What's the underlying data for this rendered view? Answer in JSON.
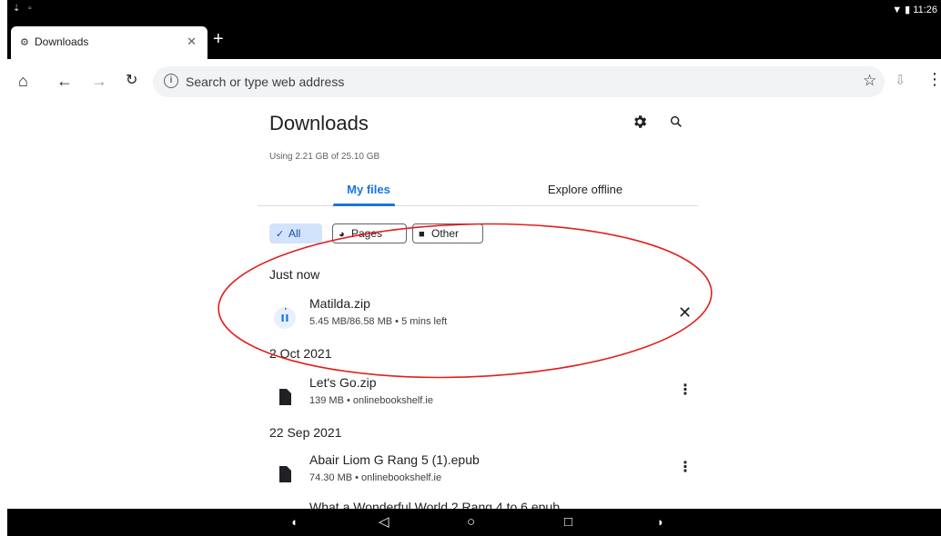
{
  "status_bar": {
    "left_icons": "⇣ ▫",
    "right_text": "▼ ▮ 11:26"
  },
  "browser": {
    "tab_title": "Downloads",
    "tab_favicon": "gear-icon",
    "new_tab_label": "+",
    "omnibox_placeholder": "Search or type web address"
  },
  "downloads": {
    "title": "Downloads",
    "storage": "Using 2.21 GB of 25.10 GB",
    "tabs": [
      "My files",
      "Explore offline"
    ],
    "active_tab": "My files",
    "filters": {
      "all": "All",
      "pages": "Pages",
      "other": "Other",
      "selected": "All"
    },
    "sections": [
      {
        "header": "Just now",
        "items": [
          {
            "name": "Matilda.zip",
            "meta": "5.45 MB/86.58 MB • 5 mins left",
            "status": "paused",
            "action": "close-icon"
          }
        ]
      },
      {
        "header": "2 Oct 2021",
        "items": [
          {
            "name": "Let's Go.zip",
            "meta": "139 MB • onlinebookshelf.ie",
            "action": "more-vert-icon"
          }
        ]
      },
      {
        "header": "22 Sep 2021",
        "items": [
          {
            "name": "Abair Liom G Rang 5 (1).epub",
            "meta": "74.30 MB • onlinebookshelf.ie",
            "action": "more-vert-icon"
          },
          {
            "name": "What a Wonderful World 2 Rang 4 to 6.epub",
            "meta": "",
            "action": "more-vert-icon"
          }
        ]
      }
    ]
  },
  "annotation": {
    "color": "#e0201b",
    "shape": "ellipse"
  },
  "colors": {
    "accent": "#1a73e8",
    "chip_selected_bg": "#d2e3fc"
  }
}
